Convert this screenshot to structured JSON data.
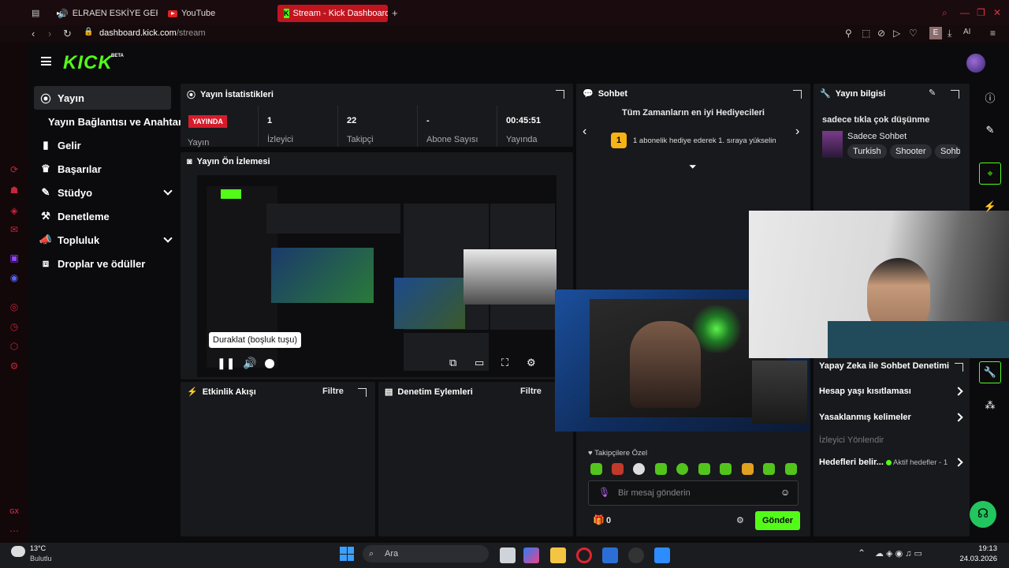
{
  "browser": {
    "tabs": [
      {
        "label": "ELRAEN ESKİYE GERİ"
      },
      {
        "label": "YouTube"
      },
      {
        "label": "Stream - Kick Dashboard"
      }
    ],
    "url_host": "dashboard.kick.com",
    "url_path": "/stream",
    "ai_label": "AI",
    "profile_letter": "E"
  },
  "kick": {
    "logo": "KICK",
    "beta": "BETA"
  },
  "nav": {
    "items": [
      {
        "label": "Yayın",
        "icon": "broadcast-icon"
      },
      {
        "label": "Yayın Bağlantısı ve Anahtarı",
        "icon": ""
      },
      {
        "label": "Gelir",
        "icon": "chart-icon"
      },
      {
        "label": "Başarılar",
        "icon": "trophy-icon"
      },
      {
        "label": "Stüdyo",
        "icon": "brush-icon"
      },
      {
        "label": "Denetleme",
        "icon": "gavel-icon"
      },
      {
        "label": "Topluluk",
        "icon": "megaphone-icon"
      },
      {
        "label": "Droplar ve ödüller",
        "icon": "gift-icon"
      }
    ]
  },
  "stats": {
    "title": "Yayın İstatistikleri",
    "live_badge": "YAYINDA",
    "status_label": "Yayın",
    "viewers": "1",
    "viewers_label": "İzleyici",
    "followers": "22",
    "followers_label": "Takipçi",
    "subs": "-",
    "subs_label": "Abone Sayısı",
    "duration": "00:45:51",
    "duration_label": "Yayında"
  },
  "preview": {
    "title": "Yayın Ön İzlemesi",
    "tooltip": "Duraklat (boşluk tuşu)"
  },
  "activity": {
    "title": "Etkinlik Akışı",
    "filter": "Filtre"
  },
  "moderation": {
    "title": "Denetim Eylemleri",
    "filter": "Filtre"
  },
  "chat": {
    "title": "Sohbet",
    "gifters_title": "Tüm Zamanların en iyi Hediyecileri",
    "rank": "1",
    "gifter_prompt": "1 abonelik hediye ederek 1. sıraya yükselin",
    "followers_only": "Takipçilere Özel",
    "input_placeholder": "Bir mesaj gönderin",
    "points": "0",
    "send_label": "Gönder"
  },
  "stream_info": {
    "title": "Yayın bilgisi",
    "stream_title": "sadece tıkla çok düşünme",
    "category": "Sadece Sohbet",
    "tags": [
      "Turkish",
      "Shooter",
      "Sohb"
    ],
    "ai_moderation": "Yapay Zeka ile Sohbet Denetimi",
    "age_restriction": "Hesap yaşı kısıtlaması",
    "banned_words": "Yasaklanmış kelimeler",
    "viewer_redirect": "İzleyici Yönlendir",
    "goals": "Hedefleri belir...",
    "active_goals": "Aktif hedefler - 1"
  },
  "taskbar": {
    "weather_temp": "13°C",
    "weather_desc": "Bulutlu",
    "search": "Ara",
    "time": "19:13",
    "date": "24.03.2026"
  },
  "colors": {
    "accent": "#53fc18",
    "live": "#d61c2c",
    "opera": "#c0151f"
  }
}
